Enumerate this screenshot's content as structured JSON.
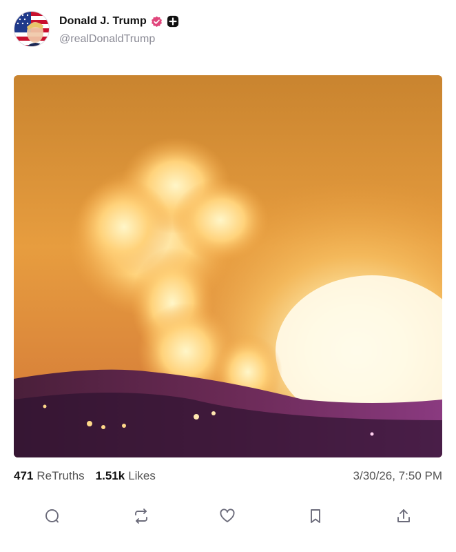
{
  "post": {
    "author_name": "Donald J. Trump",
    "handle": "@realDonaldTrump",
    "retruths_count": "471",
    "retruths_label": "ReTruths",
    "likes_count": "1.51k",
    "likes_label": "Likes",
    "timestamp": "3/30/26, 7:50 PM"
  },
  "icons": {
    "avatar": "avatar-flag-portrait",
    "verified": "verified-badge-icon",
    "plus": "plus-badge-icon",
    "reply": "comment-icon",
    "retruth": "retruth-icon",
    "like": "heart-icon",
    "bookmark": "bookmark-icon",
    "share": "share-icon"
  },
  "colors": {
    "verified": "#e0457b",
    "icon": "#6b6b7a",
    "muted_text": "#8a8a95"
  }
}
